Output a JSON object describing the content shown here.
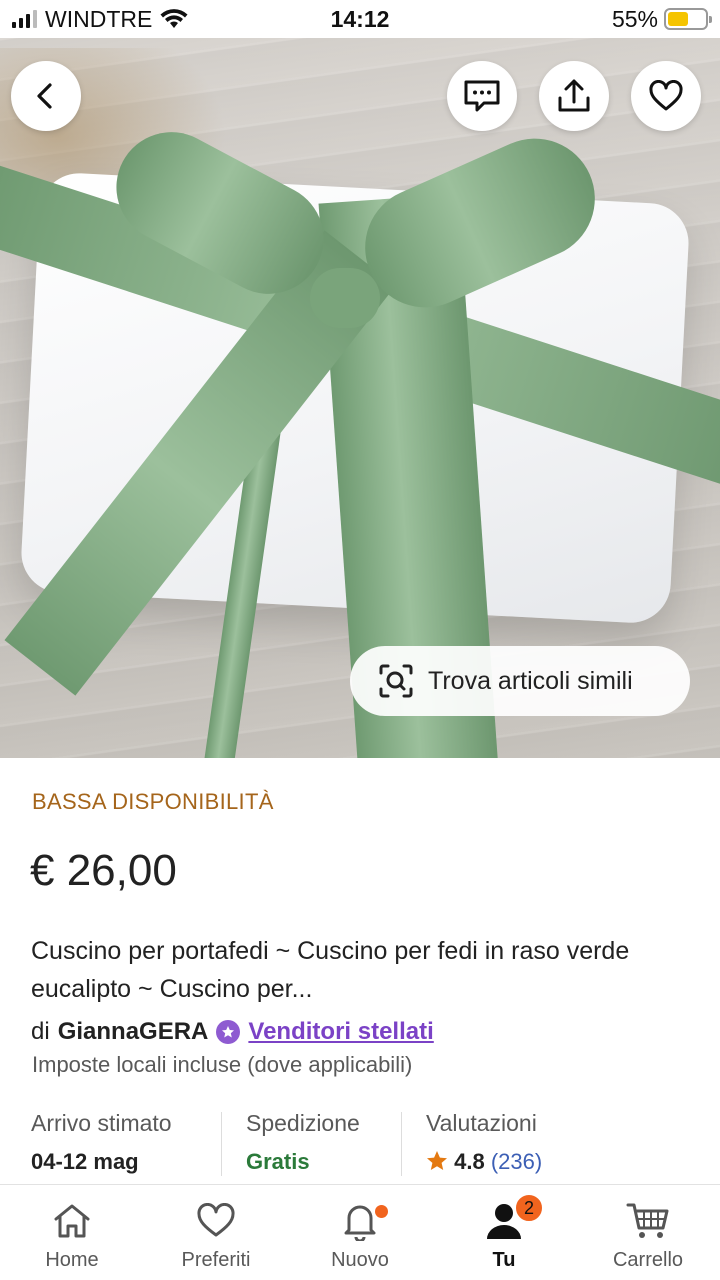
{
  "status_bar": {
    "carrier": "WINDTRE",
    "time": "14:12",
    "battery": "55%",
    "battery_level": 0.55
  },
  "hero": {
    "image_description": "",
    "similar_button_label": "Trova articoli simili",
    "icons": {
      "back": "back-arrow-icon",
      "message": "message-icon",
      "share": "share-icon",
      "favorite": "heart-icon",
      "visual_search": "visual-search-icon"
    }
  },
  "product": {
    "availability": "BASSA DISPONIBILITÀ",
    "price": "€ 26,00",
    "title": "Cuscino per portafedi ~ Cuscino per fedi in raso verde eucalipto ~ Cuscino per...",
    "seller_prefix": "di",
    "seller_name": "GiannaGERA",
    "seller_badge": "Venditori stellati",
    "tax_note": "Imposte locali incluse (dove applicabili)"
  },
  "info": {
    "arrival_label": "Arrivo stimato",
    "arrival_value": "04-12 mag",
    "shipping_label": "Spedizione",
    "shipping_value": "Gratis",
    "rating_label": "Valutazioni",
    "rating_value": "4.8",
    "rating_count": "(236)"
  },
  "tabbar": {
    "items": [
      {
        "label": "Home",
        "icon": "home-icon"
      },
      {
        "label": "Preferiti",
        "icon": "heart-icon"
      },
      {
        "label": "Nuovo",
        "icon": "bell-icon"
      },
      {
        "label": "Tu",
        "icon": "user-icon",
        "badge": "2"
      },
      {
        "label": "Carrello",
        "icon": "cart-icon"
      }
    ]
  },
  "colors": {
    "availability": "#a5651b",
    "seller_link": "#7b42c6",
    "free_shipping": "#2b7a3a",
    "rating_count": "#3c5fb5",
    "accent_orange": "#f1641e",
    "star": "#e47911"
  }
}
